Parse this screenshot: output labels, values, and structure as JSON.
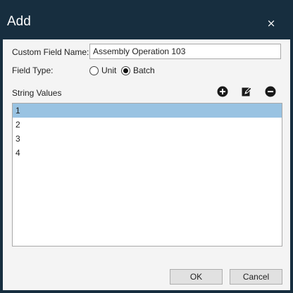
{
  "window": {
    "title": "Add",
    "close_glyph": "×"
  },
  "form": {
    "custom_field_name_label": "Custom Field Name:",
    "custom_field_name_value": "Assembly Operation 103",
    "field_type_label": "Field Type:",
    "field_type_options": [
      {
        "label": "Unit",
        "checked": false
      },
      {
        "label": "Batch",
        "checked": true
      }
    ],
    "string_values_label": "String Values"
  },
  "toolbar": {
    "icons": [
      "add-icon",
      "edit-icon",
      "remove-icon"
    ]
  },
  "list": {
    "items": [
      "1",
      "2",
      "3",
      "4"
    ],
    "selected_index": 0
  },
  "buttons": {
    "ok_label": "OK",
    "cancel_label": "Cancel"
  },
  "colors": {
    "titlebar": "#172e3f",
    "selection": "#99c3e2",
    "body": "#f4f4f4"
  }
}
